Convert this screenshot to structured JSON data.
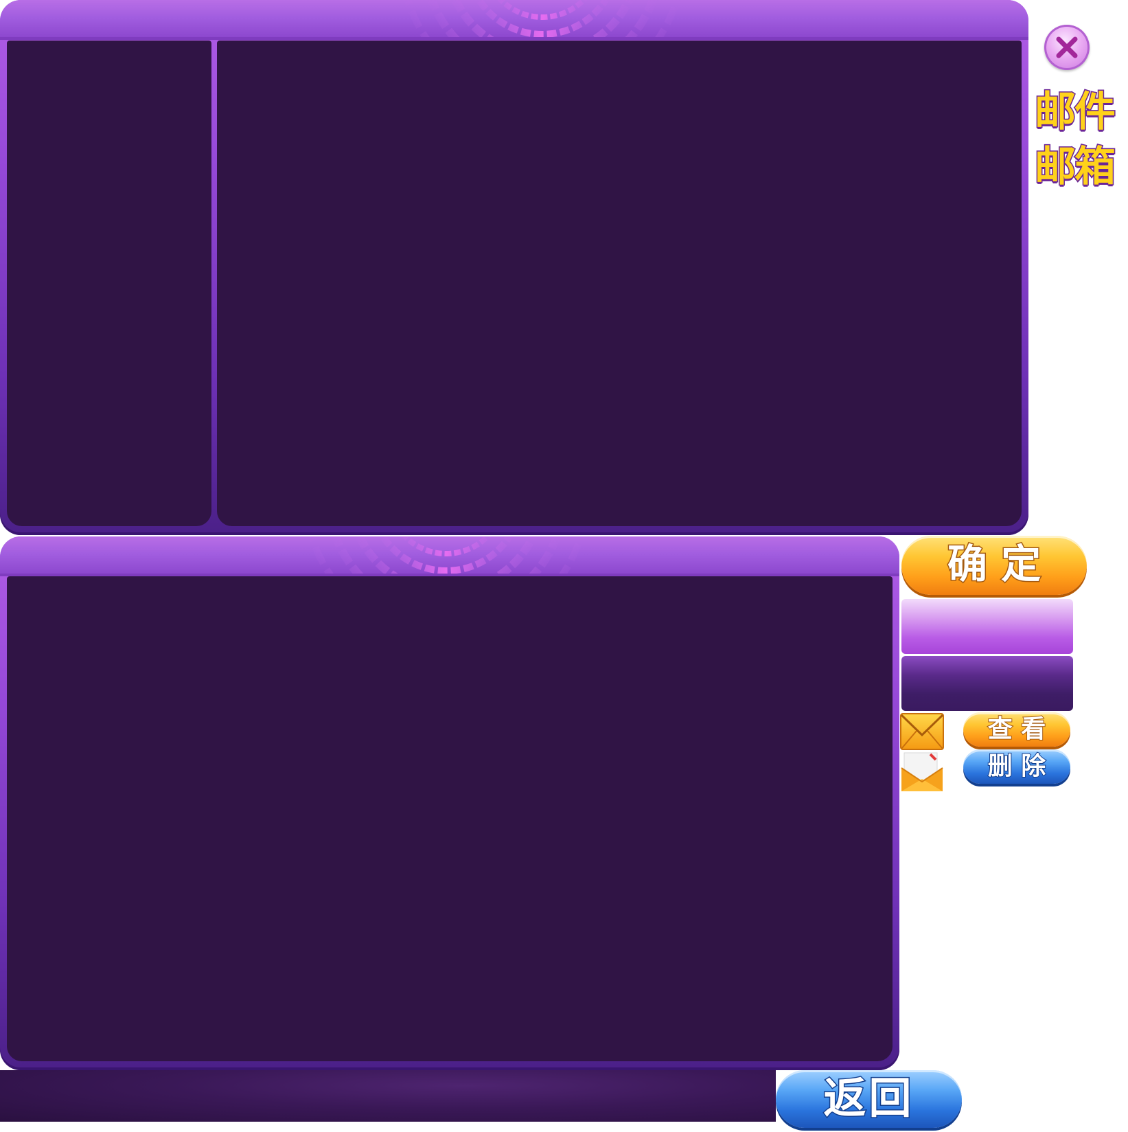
{
  "title": {
    "line1": "邮件",
    "line2": "邮箱"
  },
  "buttons": {
    "confirm": "确 定",
    "view": "查 看",
    "delete": "删 除",
    "back": "返回"
  },
  "icons": {
    "close": "close-icon",
    "mail_closed": "envelope-closed-icon",
    "mail_open": "envelope-open-icon"
  },
  "colors": {
    "panel_inner": "#301445",
    "panel_frame": "#9649d8",
    "title_fill": "#ffd21a",
    "title_outline": "#6a2497",
    "button_yellow": "#ff9f1a",
    "button_blue": "#2a74dd"
  }
}
